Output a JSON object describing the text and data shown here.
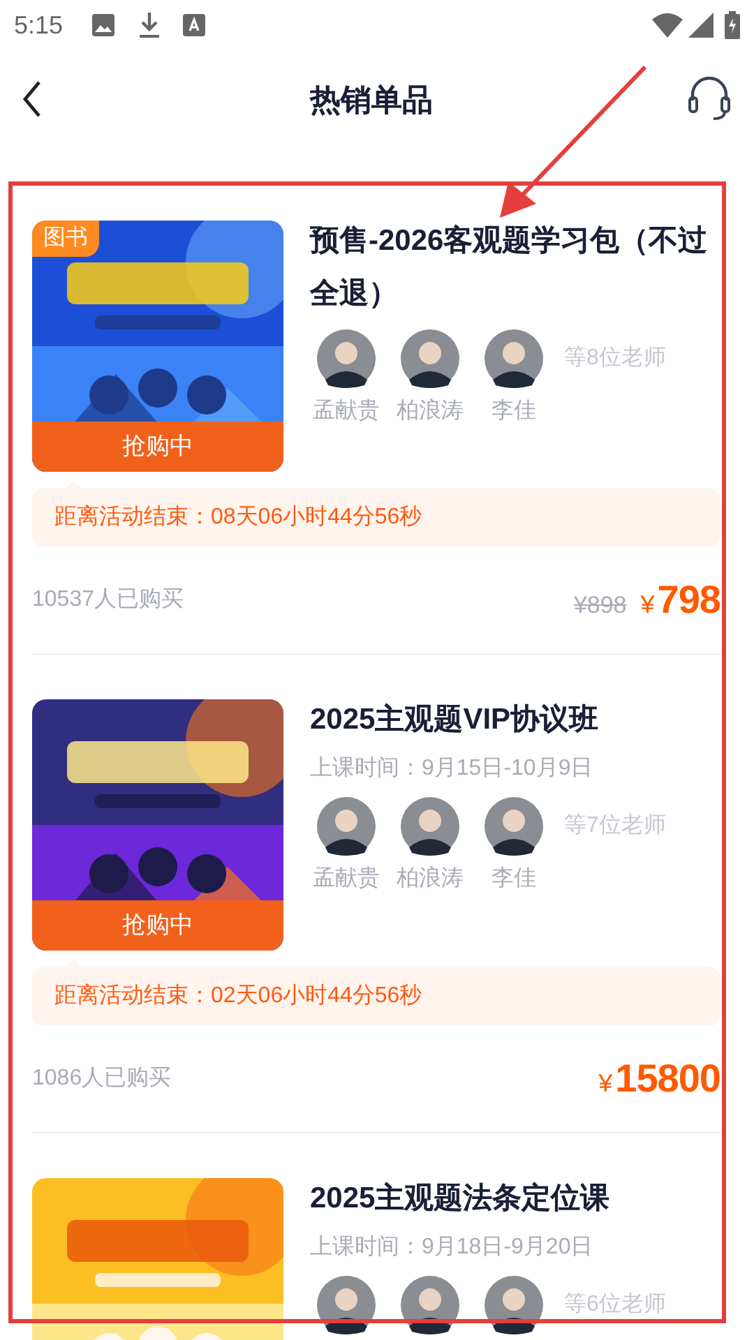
{
  "status_bar": {
    "time": "5:15"
  },
  "header": {
    "title": "热销单品"
  },
  "products": [
    {
      "tag": "图书",
      "title": "预售-2026客观题学习包（不过全退）",
      "teachers": [
        "孟献贵",
        "柏浪涛",
        "李佳"
      ],
      "teacher_count": "等8位老师",
      "status_label": "抢购中",
      "countdown": "距离活动结束：08天06小时44分56秒",
      "buyers": "10537人已购买",
      "original_price": "¥898",
      "currency": "¥",
      "price": "798"
    },
    {
      "title": "2025主观题VIP协议班",
      "schedule": "上课时间：9月15日-10月9日",
      "teachers": [
        "孟献贵",
        "柏浪涛",
        "李佳"
      ],
      "teacher_count": "等7位老师",
      "status_label": "抢购中",
      "countdown": "距离活动结束：02天06小时44分56秒",
      "buyers": "1086人已购买",
      "currency": "¥",
      "price": "15800"
    },
    {
      "title": "2025主观题法条定位课",
      "schedule": "上课时间：9月18日-9月20日",
      "teacher_count": "等6位老师"
    }
  ]
}
